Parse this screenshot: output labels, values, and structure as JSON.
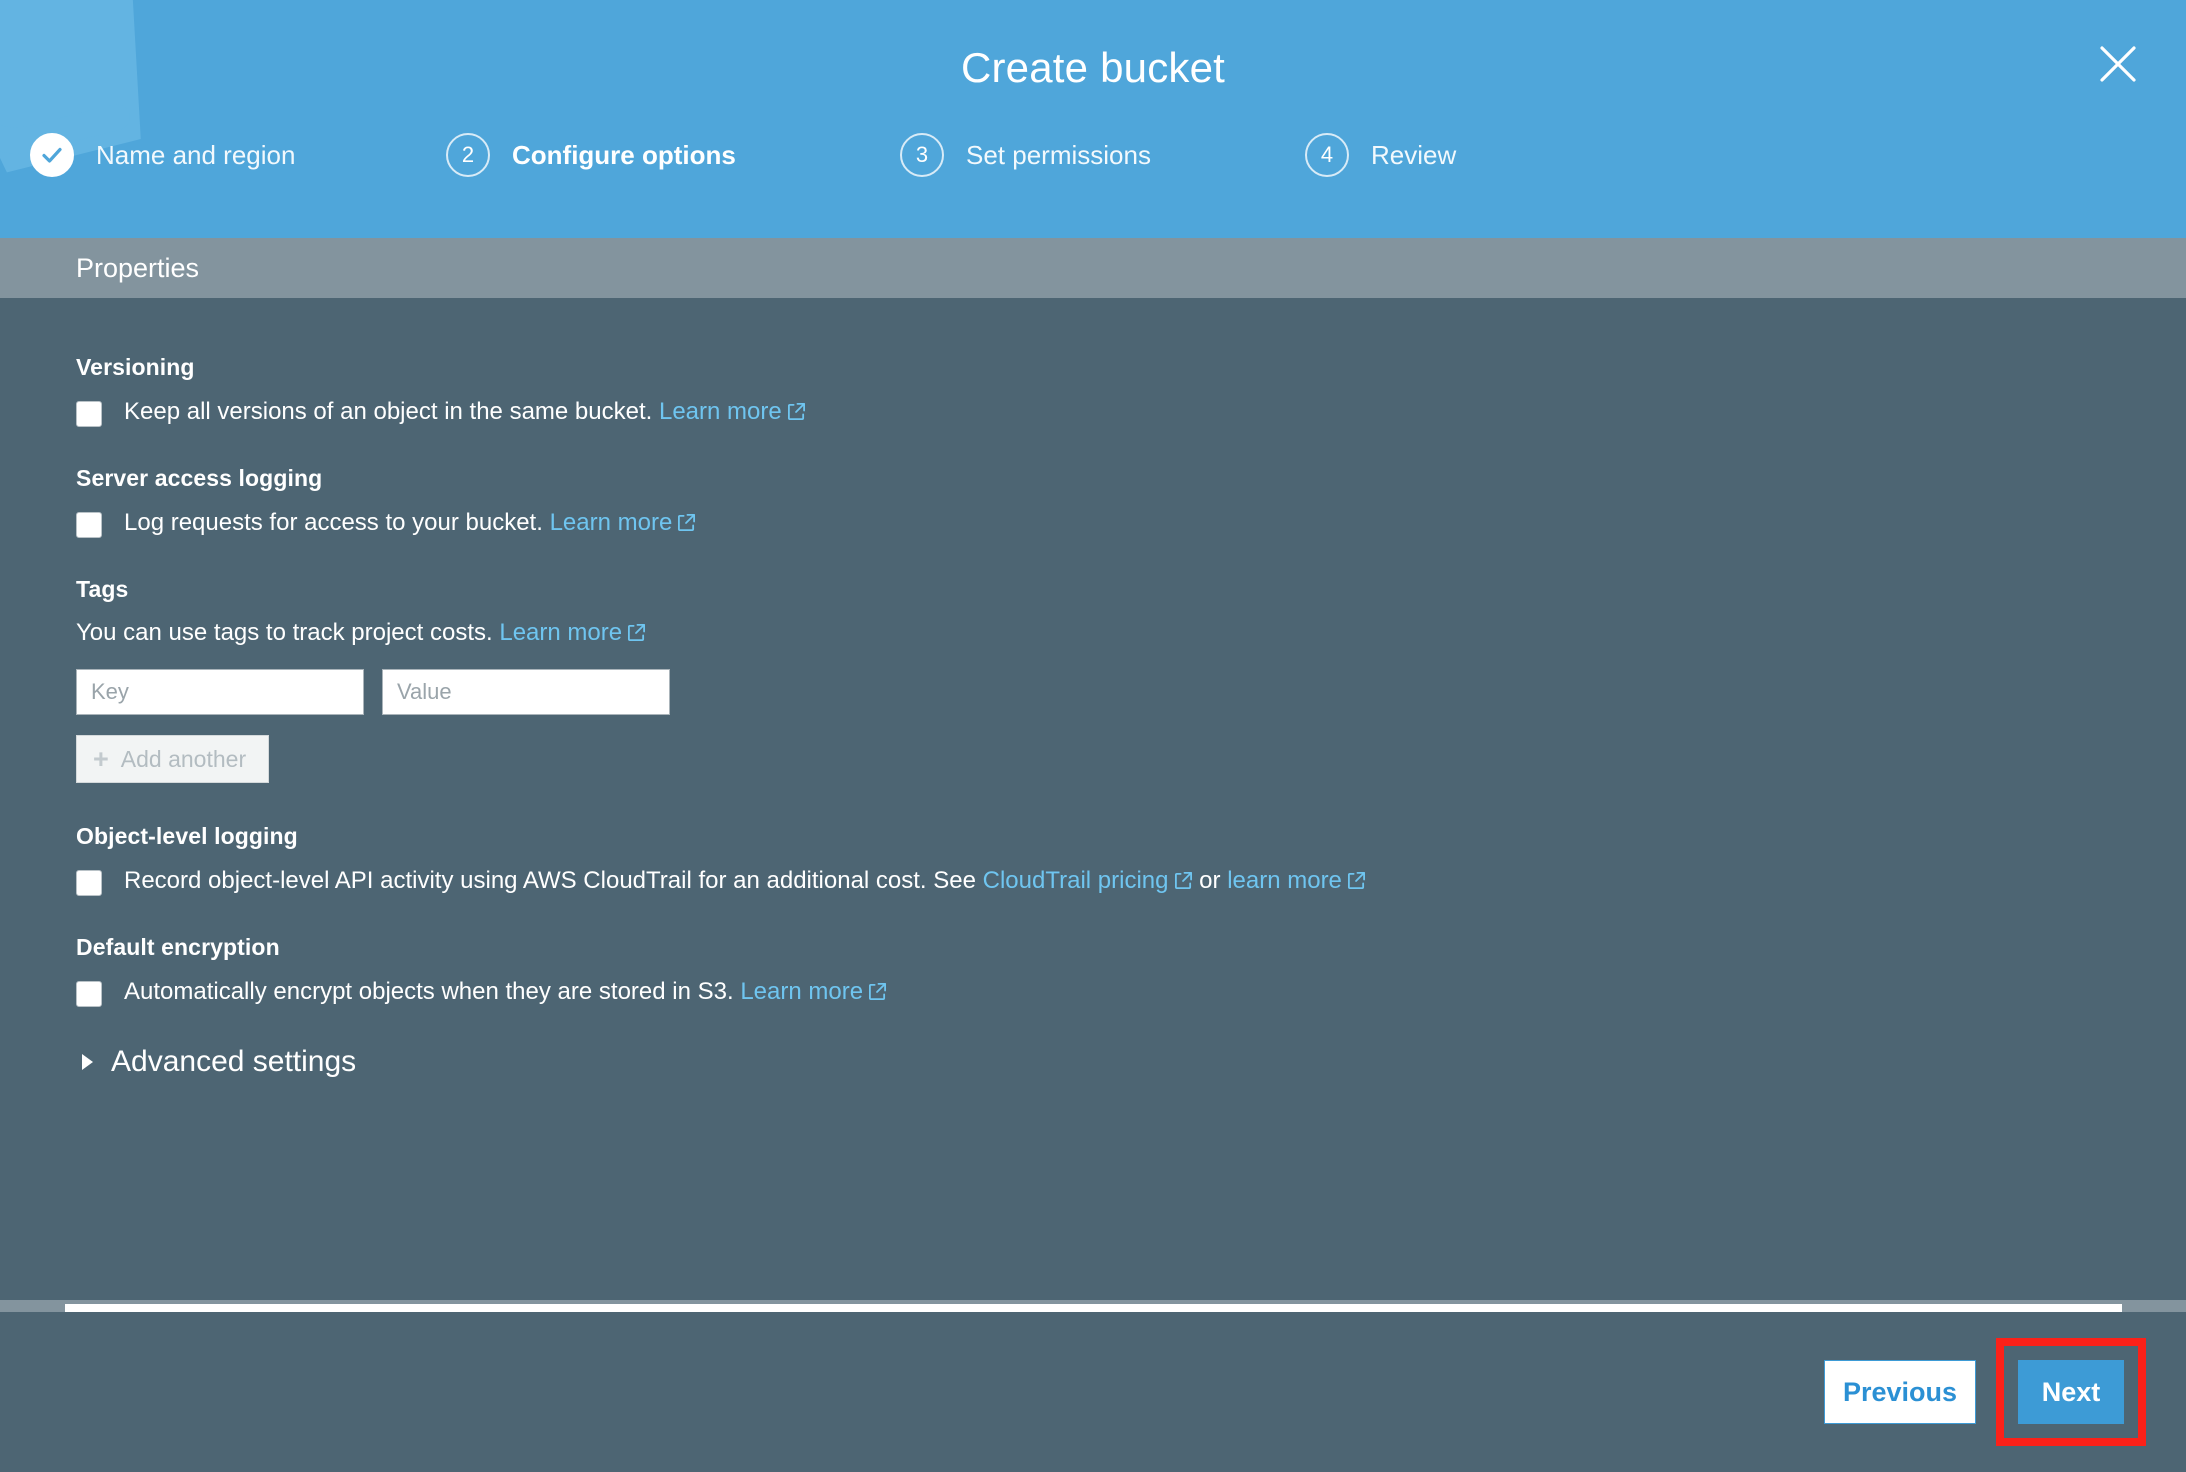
{
  "header": {
    "title": "Create bucket",
    "close_icon": "close-icon",
    "watermark_icon": "bucket-watermark-icon",
    "steps": [
      {
        "number": "1",
        "label": "Name and region",
        "state": "completed",
        "icon": "check-icon"
      },
      {
        "number": "2",
        "label": "Configure options",
        "state": "active"
      },
      {
        "number": "3",
        "label": "Set permissions",
        "state": "upcoming"
      },
      {
        "number": "4",
        "label": "Review",
        "state": "upcoming"
      }
    ]
  },
  "properties_bar": {
    "title": "Properties"
  },
  "sections": {
    "versioning": {
      "title": "Versioning",
      "checkbox_checked": false,
      "text": "Keep all versions of an object in the same bucket.",
      "link_label": "Learn more",
      "link_icon": "external-link-icon"
    },
    "server_access_logging": {
      "title": "Server access logging",
      "checkbox_checked": false,
      "text": "Log requests for access to your bucket.",
      "link_label": "Learn more",
      "link_icon": "external-link-icon"
    },
    "tags": {
      "title": "Tags",
      "description": "You can use tags to track project costs.",
      "link_label": "Learn more",
      "link_icon": "external-link-icon",
      "key_placeholder": "Key",
      "key_value": "",
      "value_placeholder": "Value",
      "value_value": "",
      "add_another_label": "Add another",
      "add_another_icon": "plus-icon",
      "add_another_disabled": true
    },
    "object_level_logging": {
      "title": "Object-level logging",
      "checkbox_checked": false,
      "text_before": "Record object-level API activity using AWS CloudTrail for an additional cost. See",
      "link1_label": "CloudTrail pricing",
      "link1_icon": "external-link-icon",
      "text_middle": "or",
      "link2_label": "learn more",
      "link2_icon": "external-link-icon"
    },
    "default_encryption": {
      "title": "Default encryption",
      "checkbox_checked": false,
      "text": "Automatically encrypt objects when they are stored in S3.",
      "link_label": "Learn more",
      "link_icon": "external-link-icon"
    },
    "advanced_settings": {
      "label": "Advanced settings",
      "expanded": false,
      "caret_icon": "chevron-right-icon"
    }
  },
  "footer": {
    "previous_label": "Previous",
    "next_label": "Next",
    "next_highlighted": true
  },
  "colors": {
    "header_blue": "#4fa6da",
    "properties_bar": "#83949e",
    "body_bg": "#4d6573",
    "link_blue": "#6fc5f0",
    "button_blue": "#3d9bd6",
    "highlight_red": "#fc2119",
    "white": "#ffffff"
  },
  "scrollbar": {
    "orientation": "horizontal",
    "position": "bottom-of-content"
  }
}
